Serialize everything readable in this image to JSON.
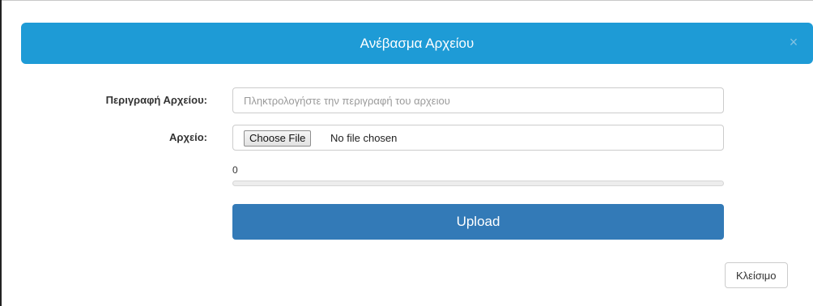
{
  "modal": {
    "title": "Ανέβασμα Αρχείου",
    "close_icon": "×",
    "close_icon_name": "close-icon"
  },
  "form": {
    "description": {
      "label": "Περιγραφή Αρχείου:",
      "value": "",
      "placeholder": "Πληκτρολογήστε την περιγραφή του αρχειου"
    },
    "file": {
      "label": "Αρχείο:",
      "button_label": "Choose File",
      "status": "No file chosen"
    },
    "progress": {
      "value_text": "0",
      "percent": 0
    },
    "upload_label": "Upload"
  },
  "footer": {
    "close_label": "Κλείσιμο"
  },
  "colors": {
    "header_bg": "#1e9bd6",
    "primary": "#337ab7",
    "header_text": "#ffffff"
  }
}
